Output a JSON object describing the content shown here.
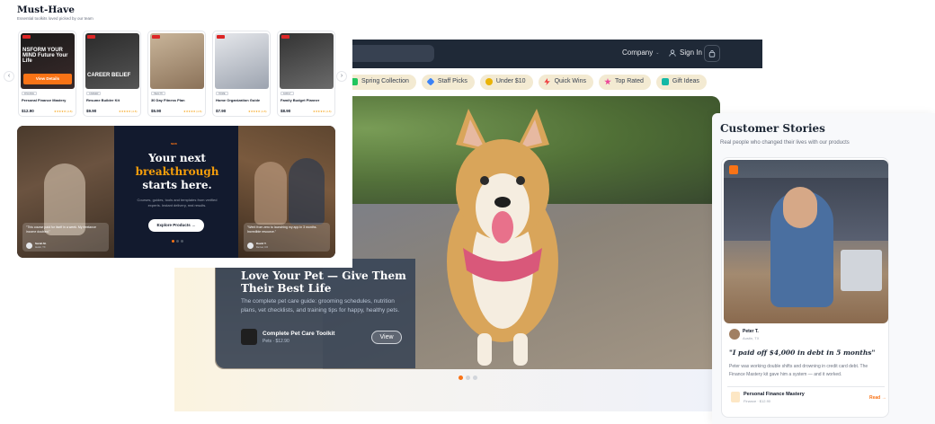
{
  "left": {
    "title": "Must-Have",
    "subtitle": "Essential toolkits loved picked by our team",
    "cards": [
      {
        "img_text": "NSFORM YOUR MIND Future Your Life",
        "btn": "View Details",
        "tag": "FINANCE",
        "name": "Personal Finance Mastery",
        "price": "$12.90",
        "stars": "★★★★★ (4.8)"
      },
      {
        "img_text": "CAREER BELIEF",
        "btn": "",
        "tag": "CAREER",
        "name": "Resume Builder Kit",
        "price": "$9.90",
        "stars": "★★★★★ (4.8)"
      },
      {
        "img_text": "",
        "btn": "",
        "tag": "HEALTH",
        "name": "30 Day Fitness Plan",
        "price": "$5.90",
        "stars": "★★★★★ (4.8)"
      },
      {
        "img_text": "",
        "btn": "",
        "tag": "HOME",
        "name": "Home Organization Guide",
        "price": "$7.90",
        "stars": "★★★★★ (4.8)"
      },
      {
        "img_text": "",
        "btn": "",
        "tag": "FAMILY",
        "name": "Family Budget Planner",
        "price": "$8.90",
        "stars": "★★★★★ (4.8)"
      }
    ],
    "promo": {
      "kicker": "NEW",
      "h1": "Your next",
      "h2": "breakthrough",
      "h3": "starts here.",
      "desc": "Courses, guides, tools and templates from verified experts. Instant delivery, real results.",
      "btn": "Explore Products →",
      "quote_left": {
        "text": "\"This course paid for itself in a week. My freelance income doubled.\"",
        "name": "Sarah M.",
        "sub": "Austin, TX"
      },
      "quote_right": {
        "text": "\"Went from zero to launching my app in 3 months. Incredible resource.\"",
        "name": "David T.",
        "sub": "Denver, CO"
      }
    }
  },
  "mid": {
    "search_placeholder": "s",
    "nav_company": "Company",
    "nav_signin": "Sign In",
    "chips": [
      {
        "label": "Spring Collection",
        "color": "#22c55e"
      },
      {
        "label": "Staff Picks",
        "color": "#3b82f6"
      },
      {
        "label": "Under $10",
        "color": "#eab308"
      },
      {
        "label": "Quick Wins",
        "color": "#ef4444"
      },
      {
        "label": "Top Rated",
        "color": "#ec4899"
      },
      {
        "label": "Gift Ideas",
        "color": "#14b8a6"
      }
    ],
    "hero": {
      "title": "Love Your Pet — Give Them Their Best Life",
      "desc": "The complete pet care guide: grooming schedules, nutrition plans, vet checklists, and training tips for happy, healthy pets.",
      "product": "Complete Pet Care Toolkit",
      "product_sub": "Pets · $12.90",
      "view": "View"
    }
  },
  "right": {
    "title": "Customer Stories",
    "subtitle": "Real people who changed their lives with our products",
    "story": {
      "name": "Peter T.",
      "loc": "Austin, TX",
      "quote": "\"I paid off $4,000 in debt in 5 months\"",
      "body": "Peter was working double shifts and drowning in credit card debt. The Finance Mastery kit gave him a system — and it worked.",
      "product": "Personal Finance Mastery",
      "product_cat": "Finance · $12.90",
      "read": "Read →"
    }
  },
  "colors": {
    "accent": "#f97316",
    "navy": "#1f2937"
  }
}
